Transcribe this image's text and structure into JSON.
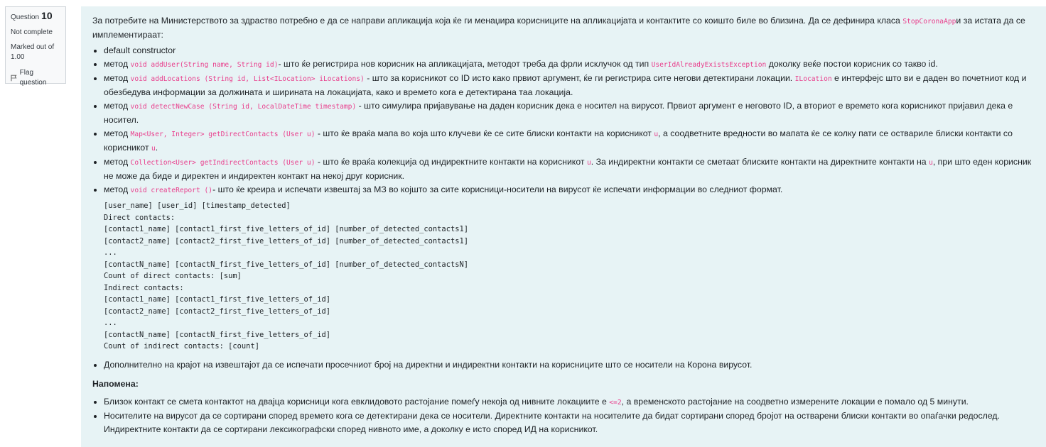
{
  "info": {
    "question_label": "Question",
    "question_number": "10",
    "status": "Not complete",
    "marked_out_of": "Marked out of 1.00",
    "flag": "Flag question"
  },
  "intro": {
    "t1": "За потребите на Министерството за здраство потребно е да се направи апликација која ќе ги менаџира корисниците на апликацијата и контактите со коишто биле во близина. Да се дефинира класа ",
    "c1": "StopCoronaApp",
    "t2": "и за истата да се имплементираат:"
  },
  "items": [
    {
      "t1": "default constructor"
    },
    {
      "t1": "метод ",
      "c1": "void addUser(String name, String id)",
      "t2": "- што ќе регистрира нов корисник на апликацијата, методот треба да фрли исклучок од тип ",
      "c2": "UserIdAlreadyExistsException",
      "t3": " доколку веќе постои корисник со такво id."
    },
    {
      "t1": "метод ",
      "c1": "void addLocations (String id, List<ILocation> iLocations)",
      "t2": " - што за корисникот со ID исто како првиот аргумент, ќе ги регистрира сите негови детектирани локации. ",
      "c2": "ILocation",
      "t3": " е интерфејс што ви е даден во почетниот код и обезбедува информации за должината и ширината на локацијата, како и времето кога е детектирана таа локација."
    },
    {
      "t1": "метод ",
      "c1": "void detectNewCase (String id, LocalDateTime timestamp)",
      "t2": " - што симулира пријавување на даден корисник дека е носител на вирусот. Првиот аргумент е неговото ID, а вториот е времето кога корисникот пријавил дека е носител."
    },
    {
      "t1": "метод ",
      "c1": "Map<User, Integer> getDirectContacts (User u)",
      "t2": " - што ќе враќа мапа во која што клучеви ќе се сите блиски контакти на корисникот ",
      "c2": "u",
      "t3": ", а соодветните вредности во мапата ќе се колку пати се оствариле блиски контакти со корисникот ",
      "c3": "u",
      "t4": "."
    },
    {
      "t1": "метод ",
      "c1": "Collection<User> getIndirectContacts (User u)",
      "t2": " - што ќе враќа колекција од индиректните контакти на корисникот ",
      "c2": "u",
      "t3": ". За индиректни контакти се сметаат блиските контакти на директните контакти на ",
      "c3": "u",
      "t4": ", при што еден корисник не може да биде и директен и индиректен контакт на некој друг корисник."
    },
    {
      "t1": "метод ",
      "c1": "void createReport ()",
      "t2": "- што ќе креира и испечати извештај за МЗ во којшто за сите корисници-носители на вирусот ќе испечати информации во следниот формат."
    }
  ],
  "format_lines": [
    "[user_name] [user_id] [timestamp_detected]",
    "Direct contacts:",
    "[contact1_name] [contact1_first_five_letters_of_id] [number_of_detected_contacts1]",
    "[contact2_name] [contact2_first_five_letters_of_id] [number_of_detected_contacts1]",
    "...",
    "[contactN_name] [contactN_first_five_letters_of_id] [number_of_detected_contactsN]",
    "Count of direct contacts: [sum]",
    "Indirect contacts:",
    "[contact1_name] [contact1_first_five_letters_of_id]",
    "[contact2_name] [contact2_first_five_letters_of_id]",
    "...",
    "[contactN_name] [contactN_first_five_letters_of_id]",
    "Count of indirect contacts: [count]"
  ],
  "extra_item": "Дополнително на крајот на извештајот да се испечати просечниот број на директни и индиректни контакти на корисниците што се носители на Корона вирусот.",
  "note_title": "Напомена:",
  "notes": [
    {
      "t1": "Близок контакт се смета контактот на двајца корисници кога евклидовото растојание помеѓу некоја од нивните локациите е ",
      "c1": "<=2",
      "t2": ", а временското растојание на соодветно измерените локации е помало од 5 минути."
    },
    {
      "t1": "Носителите на вирусот да се сортирани според времето кога се детектирани дека се носители. Директните контакти на носителите да бидат сортирани според бројот на остварени блиски контакти во опаѓачки редослед. Индиректните контакти да се сортирани лексикографски според нивното име, а доколку е исто според ИД на корисникот."
    }
  ]
}
